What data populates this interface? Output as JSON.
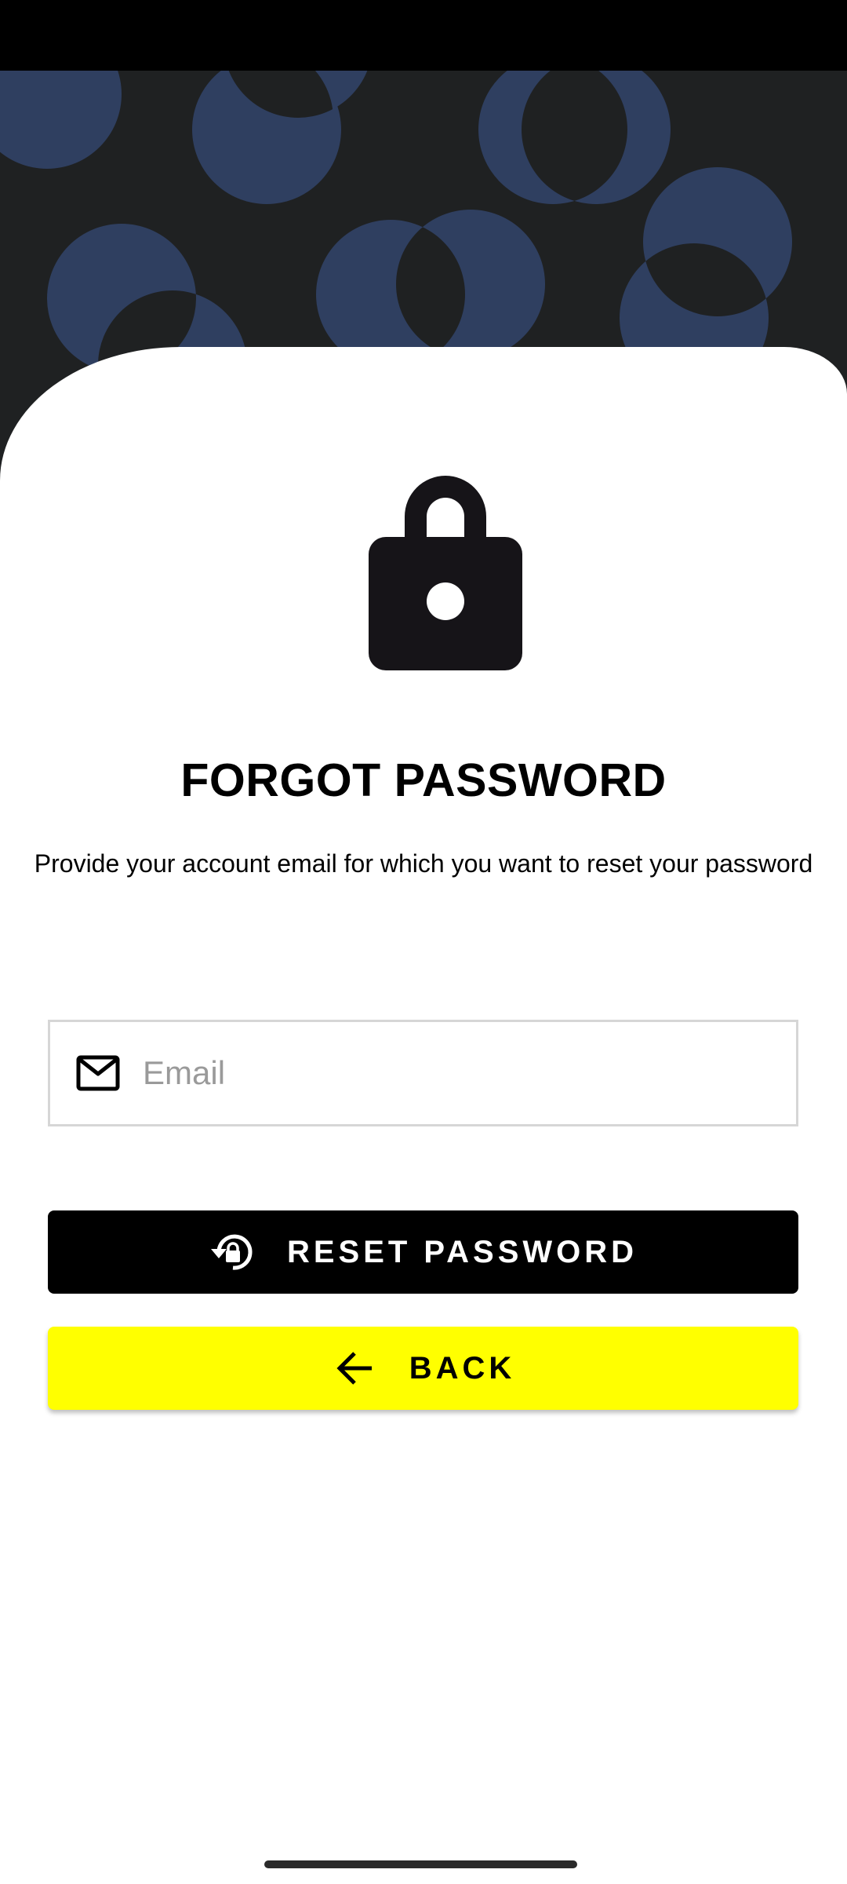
{
  "page": {
    "title": "FORGOT PASSWORD",
    "description": "Provide your account email for which you want to reset your password"
  },
  "email_field": {
    "value": "",
    "placeholder": "Email",
    "icon": "mail-icon"
  },
  "buttons": {
    "reset_label": "RESET PASSWORD",
    "reset_icon": "lock-reset-icon",
    "back_label": "BACK",
    "back_icon": "arrow-left-icon"
  },
  "header_icon": "lock-icon",
  "colors": {
    "hero_background": "#1f2122",
    "hero_circles": "#2f3f60",
    "primary_button": "#000000",
    "secondary_button": "#ffff00",
    "field_border": "#d6d6d6",
    "placeholder": "#9a9a9a"
  }
}
